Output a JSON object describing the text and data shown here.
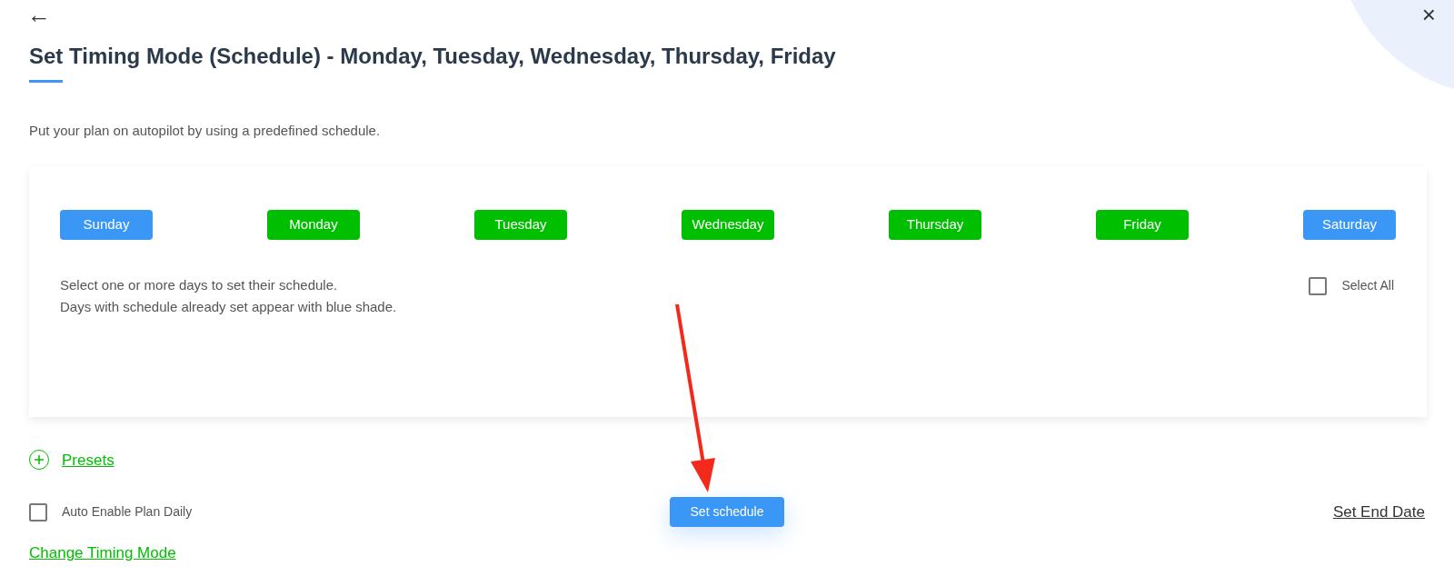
{
  "header": {
    "back": "←",
    "close": "×",
    "title": "Set Timing Mode (Schedule) - Monday, Tuesday, Wednesday, Thursday, Friday",
    "description": "Put your plan on autopilot by using a predefined schedule."
  },
  "days": [
    {
      "label": "Sunday",
      "selected": false
    },
    {
      "label": "Monday",
      "selected": true
    },
    {
      "label": "Tuesday",
      "selected": true
    },
    {
      "label": "Wednesday",
      "selected": true
    },
    {
      "label": "Thursday",
      "selected": true
    },
    {
      "label": "Friday",
      "selected": true
    },
    {
      "label": "Saturday",
      "selected": false
    }
  ],
  "hint_lines": [
    "Select one or more days to set their schedule.",
    "Days with schedule already set appear with blue shade."
  ],
  "select_all": {
    "label": "Select All",
    "checked": false
  },
  "presets": "Presets",
  "auto_enable": {
    "label": "Auto Enable Plan Daily",
    "checked": false
  },
  "set_schedule": "Set schedule",
  "set_end_date": "Set End Date",
  "change_mode": "Change Timing Mode"
}
